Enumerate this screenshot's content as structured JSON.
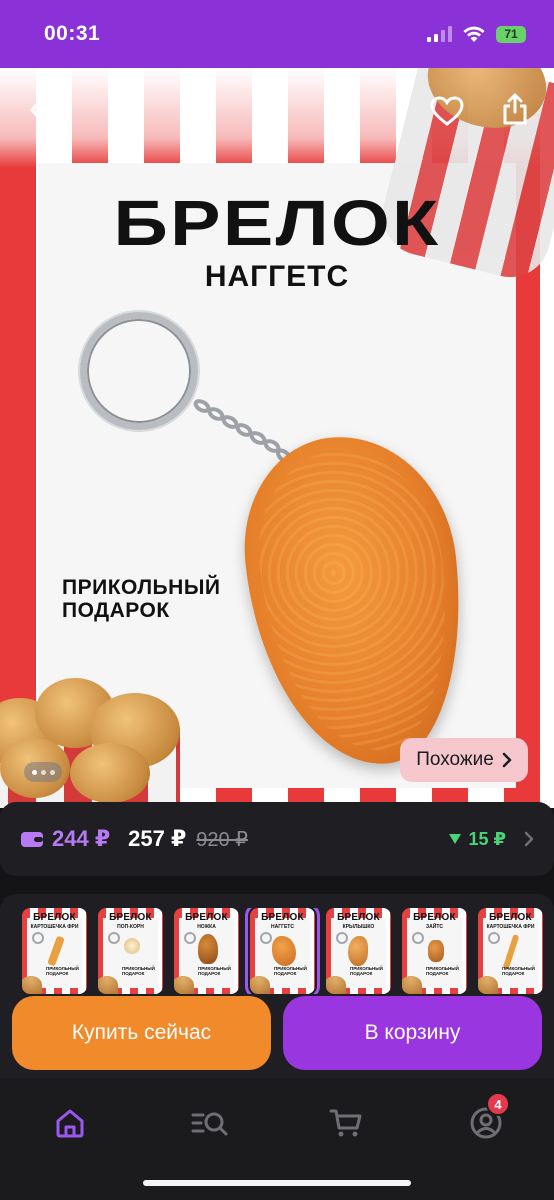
{
  "status_bar": {
    "time": "00:31",
    "battery": "71"
  },
  "hero": {
    "title": "БРЕЛОК",
    "subtitle": "НАГГЕТС",
    "caption_line1": "ПРИКОЛЬНЫЙ",
    "caption_line2": "ПОДАРОК",
    "similar_label": "Похожие"
  },
  "price": {
    "card_price": "244 ₽",
    "price": "257 ₽",
    "old_price": "920 ₽",
    "discount": "15 ₽"
  },
  "variants": [
    {
      "title": "БРЕЛОК",
      "subtitle": "КАРТОШЕЧКА ФРИ",
      "caption": "ПРИКОЛЬНЫЙ ПОДАРОК",
      "selected": false
    },
    {
      "title": "БРЕЛОК",
      "subtitle": "ПОП-КОРН",
      "caption": "ПРИКОЛЬНЫЙ ПОДАРОК",
      "selected": false
    },
    {
      "title": "БРЕЛОК",
      "subtitle": "НОЖКА",
      "caption": "ПРИКОЛЬНЫЙ ПОДАРОК",
      "selected": false
    },
    {
      "title": "БРЕЛОК",
      "subtitle": "НАГГЕТС",
      "caption": "ПРИКОЛЬНЫЙ ПОДАРОК",
      "selected": true
    },
    {
      "title": "БРЕЛОК",
      "subtitle": "КРЫЛЫШКО",
      "caption": "ПРИКОЛЬНЫЙ ПОДАРОК",
      "selected": false
    },
    {
      "title": "БРЕЛОК",
      "subtitle": "ЗАЙТС",
      "caption": "ПРИКОЛЬНЫЙ ПОДАРОК",
      "selected": false
    },
    {
      "title": "БРЕЛОК",
      "subtitle": "КАРТОШЕЧКА ФРИ",
      "caption": "ПРИКОЛЬНЫЙ ПОДАРОК",
      "selected": false
    }
  ],
  "actions": {
    "buy_now": "Купить сейчас",
    "add_to_cart": "В корзину"
  },
  "nav": {
    "profile_badge": "4"
  },
  "colors": {
    "accent_purple": "#9a36e0",
    "buy_orange": "#f18a2b",
    "card_price_purple": "#b779f4",
    "discount_green": "#4bd477",
    "badge_red": "#e5394d"
  },
  "icons": {
    "back": "chevron-left-icon",
    "favorite": "heart-icon",
    "share": "share-icon",
    "wallet": "wallet-icon",
    "discount": "triangle-down-icon",
    "home": "home-icon",
    "catalog": "catalog-search-icon",
    "cart": "cart-icon",
    "profile": "profile-icon"
  }
}
